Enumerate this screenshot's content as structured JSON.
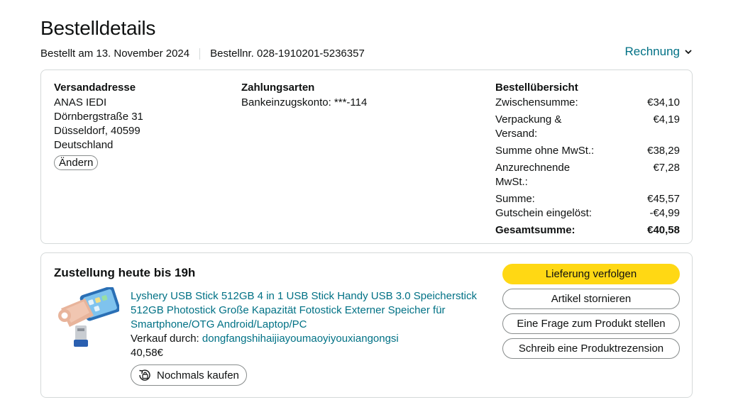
{
  "header": {
    "title": "Bestelldetails",
    "ordered_on": "Bestellt am 13. November 2024",
    "order_number": "Bestellnr. 028-1910201-5236357",
    "invoice_label": "Rechnung"
  },
  "shipping": {
    "heading": "Versandadresse",
    "lines": [
      "ANAS IEDI",
      "Dörnbergstraße 31",
      "Düsseldorf, 40599",
      "Deutschland"
    ],
    "change_label": "Ändern"
  },
  "payment": {
    "heading": "Zahlungsarten",
    "method": "Bankeinzugskonto: ***-114"
  },
  "summary": {
    "heading": "Bestellübersicht",
    "rows": [
      {
        "label": "Zwischensumme:",
        "value": "€34,10"
      },
      {
        "label": "Verpackung & Versand:",
        "value": "€4,19"
      },
      {
        "label": "Summe ohne MwSt.:",
        "value": "€38,29"
      },
      {
        "label": "Anzurechnende MwSt.:",
        "value": "€7,28"
      },
      {
        "label": "Summe:",
        "value": "€45,57"
      },
      {
        "label": "Gutschein eingelöst:",
        "value": "-€4,99"
      }
    ],
    "total_label": "Gesamtsumme:",
    "total_value": "€40,58"
  },
  "delivery": {
    "title": "Zustellung heute bis 19h",
    "product_title": "Lyshery USB Stick 512GB 4 in 1 USB Stick Handy USB 3.0 Speicherstick 512GB Photostick Große Kapazität Fotostick Externer Speicher für Smartphone/OTG Android/Laptop/PC",
    "sold_by_label": "Verkauf durch: ",
    "seller": "dongfangshihaijiayoumaoyiyouxiangongsi",
    "price": "40,58€",
    "buy_again_label": "Nochmals kaufen"
  },
  "actions": {
    "track": "Lieferung verfolgen",
    "cancel": "Artikel stornieren",
    "question": "Eine Frage zum Produkt stellen",
    "review": "Schreib eine Produktrezension"
  },
  "colors": {
    "link": "#007185",
    "primary_button": "#ffd814",
    "border": "#d5d9d9"
  }
}
